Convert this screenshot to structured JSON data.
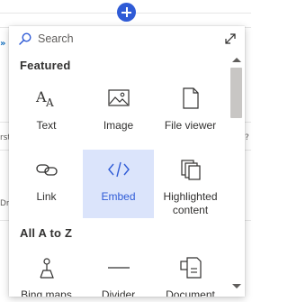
{
  "background": {
    "fragments": [
      "rst",
      "?",
      "Drc",
      "ca",
      "ca"
    ]
  },
  "add_button": {
    "icon": "plus-icon"
  },
  "search": {
    "placeholder": "Search",
    "icon": "search-icon",
    "expand_icon": "expand-icon"
  },
  "sections": {
    "featured": "Featured",
    "all": "All A to Z"
  },
  "featured_items": [
    {
      "label": "Text",
      "icon": "text-icon"
    },
    {
      "label": "Image",
      "icon": "image-icon"
    },
    {
      "label": "File viewer",
      "icon": "file-viewer-icon"
    },
    {
      "label": "Link",
      "icon": "link-icon"
    },
    {
      "label": "Embed",
      "icon": "embed-icon",
      "selected": true
    },
    {
      "label": "Highlighted content",
      "icon": "highlighted-content-icon"
    }
  ],
  "all_items": [
    {
      "label": "Bing maps",
      "icon": "map-pin-icon"
    },
    {
      "label": "Divider",
      "icon": "divider-icon"
    },
    {
      "label": "Document library",
      "icon": "document-library-icon"
    }
  ],
  "colors": {
    "accent": "#2f5bd6",
    "selected_tile": "#dbe4fb"
  }
}
